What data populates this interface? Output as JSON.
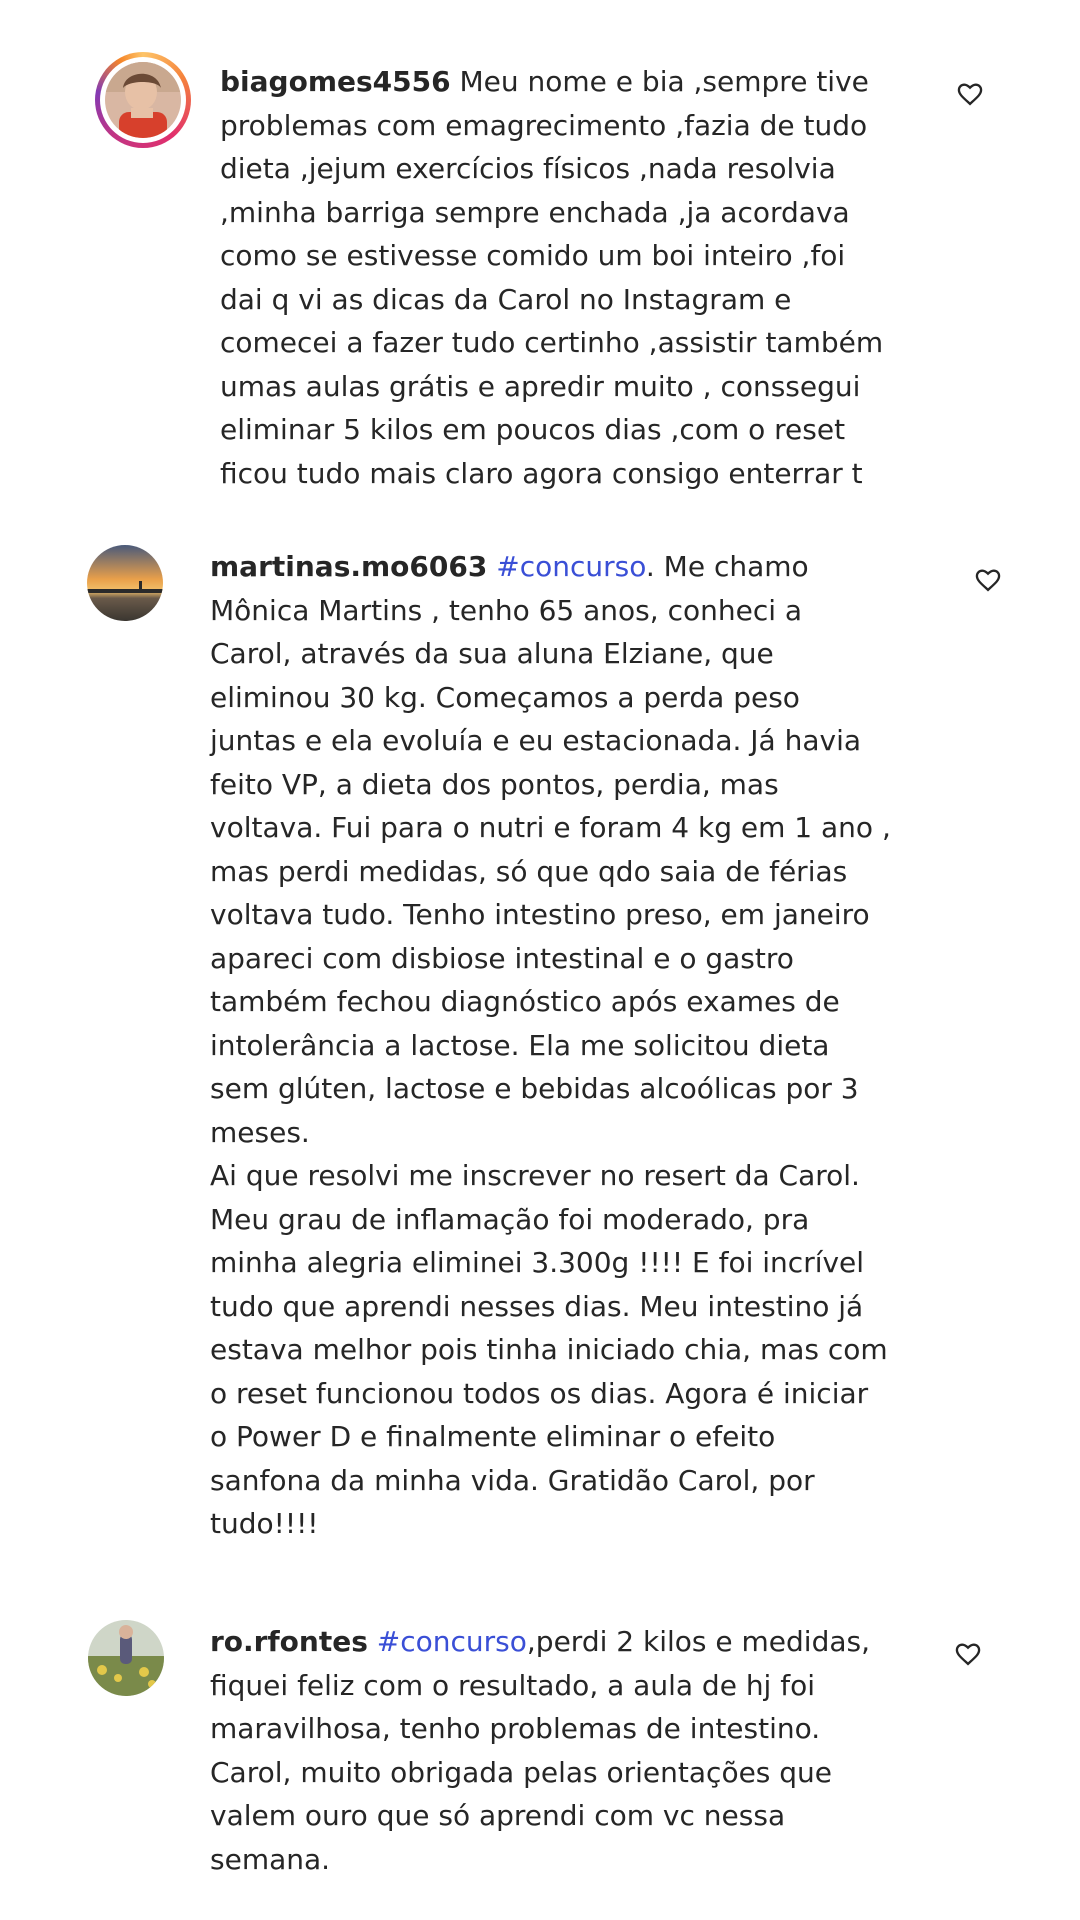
{
  "comments": [
    {
      "username": "biagomes4556",
      "hashtag": "",
      "text": " Meu nome e bia ,sempre tive\nproblemas com emagrecimento ,fazia de tudo\ndieta ,jejum exercícios físicos ,nada resolvia\n,minha barriga sempre enchada ,ja acordava\ncomo se estivesse comido um boi inteiro ,foi\ndai q vi as dicas da Carol no Instagram e\ncomecei a fazer tudo certinho ,assistir também\numas aulas grátis e apredir muito , conssegui\neliminar 5 kilos em poucos dias ,com o reset\nficou tudo mais claro agora consigo enterrar t",
      "like_icon": "heart-outline-icon"
    },
    {
      "username": "martinas.mo6063",
      "hashtag": "#concurso",
      "text": ". Me chamo\nMônica Martins , tenho 65 anos, conheci a\nCarol, através da sua aluna Elziane, que\neliminou 30 kg. Começamos a perda peso\njuntas e ela evoluía e eu estacionada. Já havia\nfeito VP, a dieta dos pontos, perdia, mas\nvoltava. Fui para o nutri e foram 4 kg em 1 ano ,\nmas perdi medidas, só que qdo saia de férias\nvoltava tudo. Tenho intestino preso, em janeiro\napareci com disbiose intestinal e o gastro\ntambém fechou diagnóstico após exames de\nintolerância a lactose. Ela me solicitou dieta\nsem glúten, lactose e bebidas alcoólicas por 3\nmeses.\nAi que resolvi me inscrever no resert da Carol.\nMeu grau de inflamação foi moderado, pra\nminha alegria eliminei 3.300g !!!! E foi incrível\ntudo que aprendi nesses dias. Meu intestino já\nestava melhor pois tinha iniciado chia, mas com\no reset funcionou todos os dias. Agora é iniciar\no Power D e finalmente eliminar o efeito\nsanfona da minha vida. Gratidão Carol, por\ntudo!!!!",
      "like_icon": "heart-outline-icon"
    },
    {
      "username": "ro.rfontes",
      "hashtag": "#concurso",
      "text": ",perdi 2 kilos e medidas,\nfiquei feliz com o resultado, a aula de hj foi\nmaravilhosa, tenho problemas de intestino.\nCarol, muito obrigada pelas orientações que\nvalem ouro que só aprendi com vc nessa\nsemana.",
      "like_icon": "heart-outline-icon"
    }
  ],
  "colors": {
    "text": "#262626",
    "hashtag": "#3a4fd6",
    "background": "#ffffff"
  }
}
